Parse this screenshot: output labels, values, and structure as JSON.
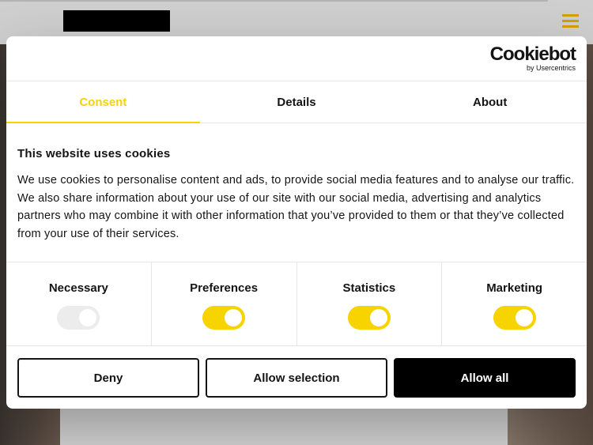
{
  "dialog": {
    "brand": {
      "name": "Cookiebot",
      "by": "by Usercentrics"
    },
    "tabs": [
      {
        "label": "Consent",
        "active": true
      },
      {
        "label": "Details",
        "active": false
      },
      {
        "label": "About",
        "active": false
      }
    ],
    "heading": "This website uses cookies",
    "description": "We use cookies to personalise content and ads, to provide social media features and to analyse our traffic. We also share information about your use of our site with our social media, advertising and analytics partners who may combine it with other information that you’ve provided to them or that they’ve collected from your use of their services.",
    "toggles": [
      {
        "label": "Necessary",
        "on": true,
        "disabled": true
      },
      {
        "label": "Preferences",
        "on": true,
        "disabled": false
      },
      {
        "label": "Statistics",
        "on": true,
        "disabled": false
      },
      {
        "label": "Marketing",
        "on": true,
        "disabled": false
      }
    ],
    "buttons": {
      "deny": "Deny",
      "allow_selection": "Allow selection",
      "allow_all": "Allow all"
    }
  },
  "colors": {
    "accent": "#f7d300",
    "menu_icon": "#d4a000",
    "text": "#141414"
  }
}
